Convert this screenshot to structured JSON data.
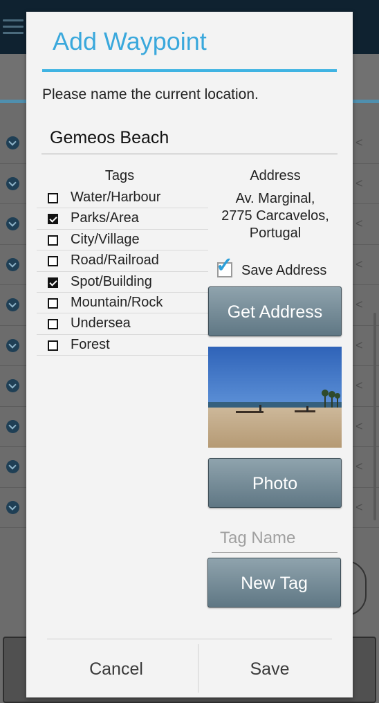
{
  "dialog": {
    "title": "Add Waypoint",
    "prompt": "Please name the current location.",
    "name_value": "Gemeos Beach"
  },
  "tags": {
    "header": "Tags",
    "items": [
      {
        "label": "Water/Harbour",
        "checked": false
      },
      {
        "label": "Parks/Area",
        "checked": true
      },
      {
        "label": "City/Village",
        "checked": false
      },
      {
        "label": "Road/Railroad",
        "checked": false
      },
      {
        "label": "Spot/Building",
        "checked": true
      },
      {
        "label": "Mountain/Rock",
        "checked": false
      },
      {
        "label": "Undersea",
        "checked": false
      },
      {
        "label": "Forest",
        "checked": false
      }
    ]
  },
  "address": {
    "header": "Address",
    "lines": [
      "Av. Marginal,",
      "2775 Carcavelos,",
      "Portugal"
    ],
    "save_address_label": "Save Address",
    "save_address_checked": true,
    "get_address_label": "Get Address"
  },
  "photo": {
    "button_label": "Photo",
    "icon": "beach-photo"
  },
  "new_tag": {
    "placeholder": "Tag Name",
    "button_label": "New Tag"
  },
  "footer": {
    "cancel_label": "Cancel",
    "save_label": "Save"
  },
  "colors": {
    "accent": "#3aa8dc",
    "title_rule": "#3fb3e2",
    "button_top": "#8fa3ad",
    "button_bottom": "#5f7784",
    "check_accent": "#2d9fd9"
  }
}
